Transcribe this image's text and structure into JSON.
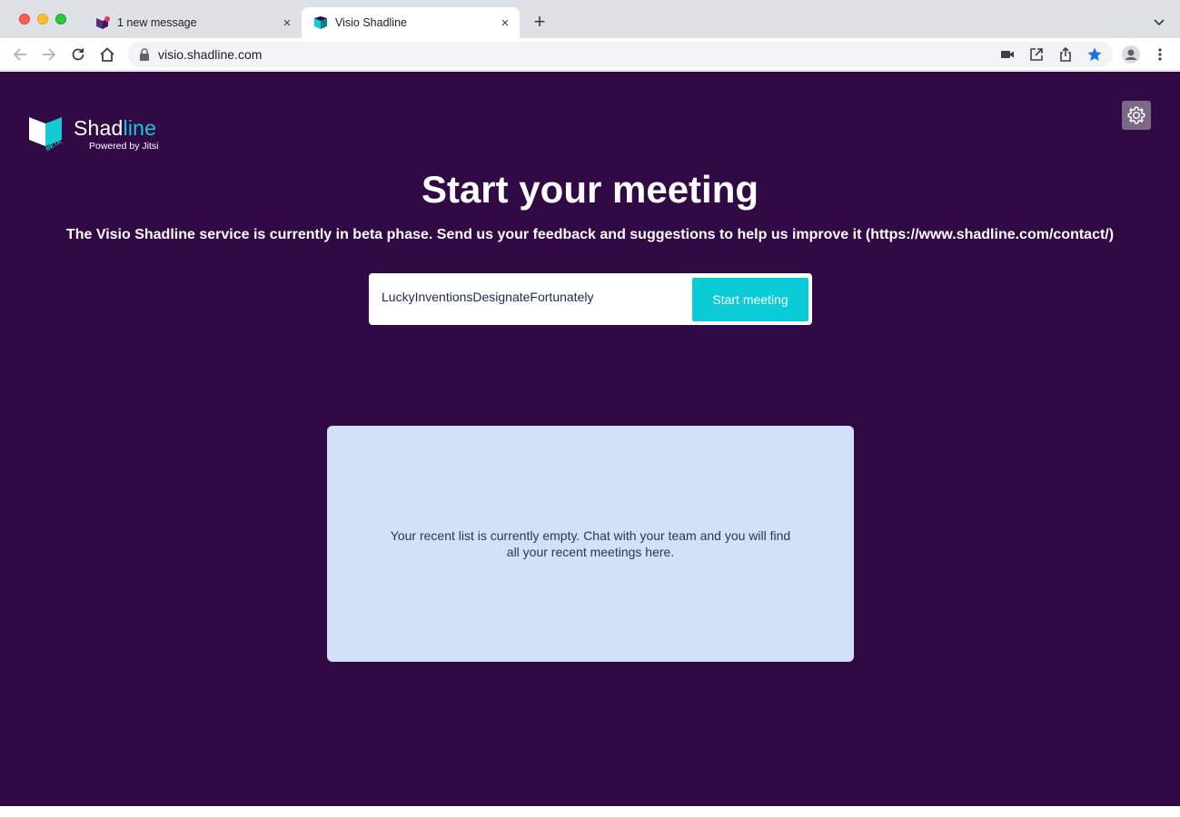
{
  "browser": {
    "tabs": [
      {
        "title": "1 new message",
        "active": false
      },
      {
        "title": "Visio Shadline",
        "active": true
      }
    ],
    "close_glyph": "×",
    "new_tab_glyph": "+",
    "url": "visio.shadline.com"
  },
  "logo": {
    "word_main": "Shad",
    "word_accent": "line",
    "subtitle": "Powered by Jitsi",
    "badge": "BETA"
  },
  "main": {
    "heading": "Start your meeting",
    "beta_notice": "The Visio Shadline service is currently in beta phase. Send us your feedback and suggestions to help us improve it (https://www.shadline.com/contact/)",
    "room_name_value": "LuckyInventionsDesignateFortunately",
    "start_button_label": "Start meeting",
    "recent_empty_text": "Your recent list is currently empty. Chat with your team and you will find all your recent meetings here."
  },
  "colors": {
    "page_background": "#310a45",
    "accent": "#0acbd6",
    "recent_panel": "#d1e1f9",
    "settings_button": "#7a6a86"
  },
  "icons": [
    "shadline-logo-icon",
    "settings-gear-icon",
    "lock-icon",
    "back-arrow-icon",
    "forward-arrow-icon",
    "reload-icon",
    "home-icon",
    "camera-icon",
    "open-external-icon",
    "share-icon",
    "bookmark-star-icon",
    "profile-icon",
    "more-vert-icon",
    "tab-list-chevron-icon"
  ]
}
